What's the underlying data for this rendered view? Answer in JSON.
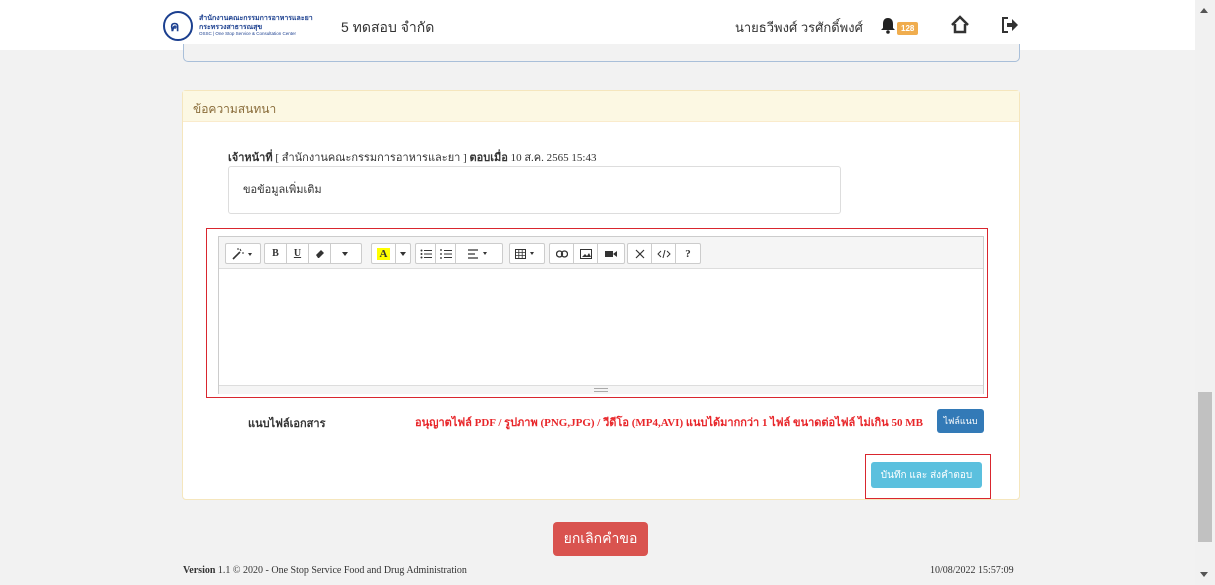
{
  "header": {
    "logo": {
      "line1": "สำนักงานคณะกรรมการอาหารและยา",
      "line2": "กระทรวงสาธารณสุข",
      "line3": "OSSC | One Stop Service & Consultation Center"
    },
    "company": "5 ทดสอบ จำกัด",
    "user_name": "นายธวีพงศ์ วรศักดิ์พงศ์",
    "notification_count": "128"
  },
  "panel": {
    "title": "ข้อความสนทนา",
    "message": {
      "role": "เจ้าหน้าที่",
      "org": " [ สำนักงานคณะกรรมการอาหารและยา ] ",
      "reply_label": "ตอบเมื่อ",
      "date": " 10 ส.ค. 2565 15:43",
      "text": "ขอข้อมูลเพิ่มเติม"
    },
    "attach_label": "แนบไฟล์เอกสาร",
    "attach_note": "อนุญาตไฟล์ PDF / รูปภาพ (PNG,JPG) / วีดีโอ (MP4,AVI) แนบได้มากกว่า 1 ไฟล์ ขนาดต่อไฟล์ ไม่เกิน 50 MB",
    "attach_button": "ไฟล์แนบ",
    "save_button": "บันทึก และ ส่งคำตอบ"
  },
  "editor_toolbar": {
    "bold": "B",
    "underline": "U",
    "font_color": "A",
    "help": "?"
  },
  "cancel_button": "ยกเลิกคำขอ",
  "footer": {
    "version_label": "Version",
    "version_text": " 1.1 © 2020 - One Stop Service Food and Drug Administration",
    "datetime": "10/08/2022 15:57:09"
  },
  "colors": {
    "highlight_border": "#d9262e",
    "panel_header": "#fcf8e3",
    "save_button": "#5bc0de",
    "attach_button": "#337ab7",
    "cancel_button": "#d9534f",
    "attach_note": "#e8262a"
  }
}
